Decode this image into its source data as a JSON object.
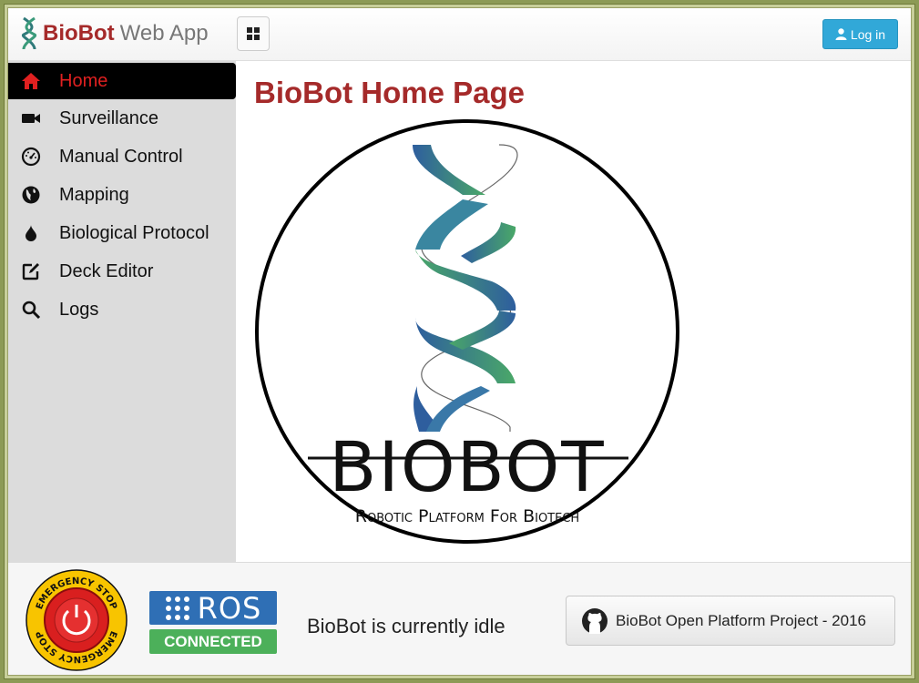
{
  "header": {
    "brand_name": "BioBot",
    "brand_sub": "Web App",
    "login_label": "Log in"
  },
  "sidebar": {
    "items": [
      {
        "label": "Home",
        "icon": "home-icon",
        "active": true
      },
      {
        "label": "Surveillance",
        "icon": "video-camera-icon"
      },
      {
        "label": "Manual Control",
        "icon": "dashboard-icon"
      },
      {
        "label": "Mapping",
        "icon": "globe-icon"
      },
      {
        "label": "Biological Protocol",
        "icon": "drop-icon"
      },
      {
        "label": "Deck Editor",
        "icon": "edit-icon"
      },
      {
        "label": "Logs",
        "icon": "search-icon"
      }
    ]
  },
  "main": {
    "title": "BioBot Home Page",
    "logo_word": "BIOBOT",
    "logo_tagline": "Robotic Platform For Biotech"
  },
  "footer": {
    "estop_label": "EMERGENCY STOP",
    "ros_label": "ROS",
    "ros_status": "CONNECTED",
    "status_text": "BioBot is currently idle",
    "github_label": "BioBot Open Platform Project - 2016"
  },
  "colors": {
    "brand": "#a52a2a",
    "active_nav": "#e02020",
    "login": "#31a8d8",
    "ros_blue": "#2f6fb5",
    "ros_green": "#4cb05a"
  }
}
